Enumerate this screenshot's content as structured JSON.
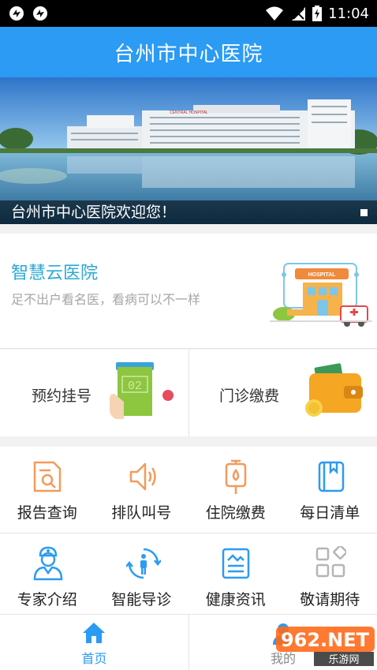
{
  "status_bar": {
    "time": "11:04"
  },
  "header": {
    "title": "台州市中心医院"
  },
  "banner": {
    "caption": "台州市中心医院欢迎您！",
    "sign_text": "CENTRAL HOSPITAL"
  },
  "smart_hospital": {
    "title": "智慧云医院",
    "subtitle": "足不出户看名医，看病可以不一样",
    "badge": "HOSPITAL"
  },
  "quick_actions": [
    {
      "label": "预约挂号",
      "icon": "registration-card-icon",
      "number": "02"
    },
    {
      "label": "门诊缴费",
      "icon": "wallet-icon"
    }
  ],
  "services": [
    {
      "label": "报告查询",
      "icon": "report-search-icon"
    },
    {
      "label": "排队叫号",
      "icon": "speaker-icon"
    },
    {
      "label": "住院缴费",
      "icon": "iv-drip-icon"
    },
    {
      "label": "每日清单",
      "icon": "notebook-icon"
    },
    {
      "label": "专家介绍",
      "icon": "doctor-icon"
    },
    {
      "label": "智能导诊",
      "icon": "guide-icon"
    },
    {
      "label": "健康资讯",
      "icon": "news-icon"
    },
    {
      "label": "敬请期待",
      "icon": "grid-shapes-icon"
    }
  ],
  "tabs": [
    {
      "label": "首页",
      "icon": "home-icon",
      "active": true
    },
    {
      "label": "我的",
      "icon": "user-icon",
      "active": false
    }
  ],
  "watermark": {
    "main": "962.NET",
    "sub": "乐游网"
  },
  "colors": {
    "primary": "#2b9bf4",
    "service_orange": "#f29b5c",
    "service_blue": "#2b9bf4",
    "service_gray": "#b5b5b5",
    "smart_title": "#2aa9d6"
  }
}
